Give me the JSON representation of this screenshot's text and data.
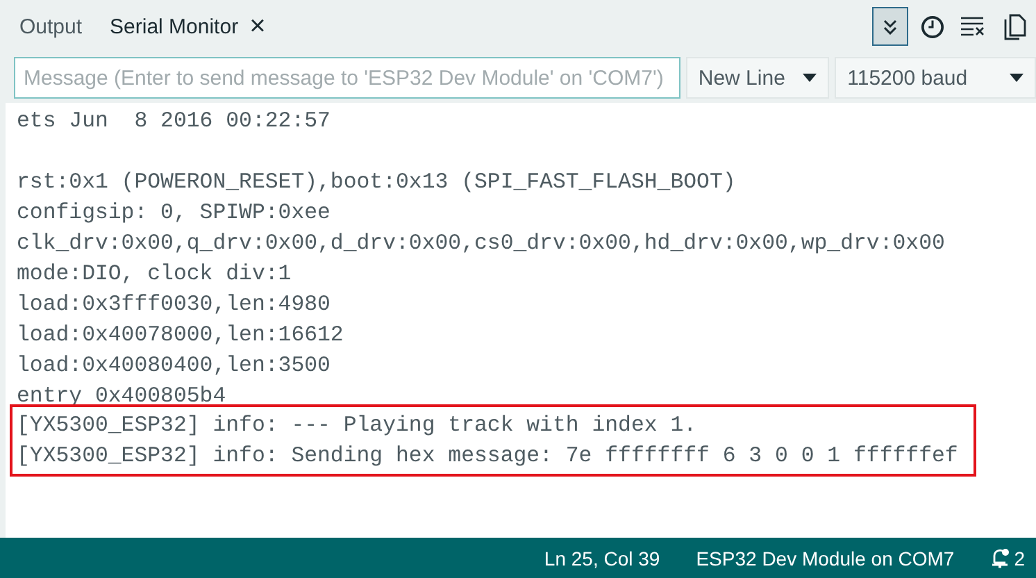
{
  "tabs": [
    {
      "label": "Output",
      "selected": false,
      "closable": false
    },
    {
      "label": "Serial Monitor",
      "selected": true,
      "closable": true,
      "close_glyph": "×"
    }
  ],
  "toolbar": {
    "autoscroll_on": true,
    "timestamp_on": false
  },
  "message_field": {
    "placeholder": "Message (Enter to send message to 'ESP32 Dev Module' on 'COM7')"
  },
  "line_ending": {
    "value": "New Line"
  },
  "baud_rate": {
    "value": "115200 baud"
  },
  "log": [
    {
      "kind": "text",
      "text": "ets Jun  8 2016 00:22:57"
    },
    {
      "kind": "blank"
    },
    {
      "kind": "text",
      "text": "rst:0x1 (POWERON_RESET),boot:0x13 (SPI_FAST_FLASH_BOOT)"
    },
    {
      "kind": "text",
      "text": "configsip: 0, SPIWP:0xee"
    },
    {
      "kind": "text",
      "text": "clk_drv:0x00,q_drv:0x00,d_drv:0x00,cs0_drv:0x00,hd_drv:0x00,wp_drv:0x00"
    },
    {
      "kind": "text",
      "text": "mode:DIO, clock div:1"
    },
    {
      "kind": "text",
      "text": "load:0x3fff0030,len:4980"
    },
    {
      "kind": "text",
      "text": "load:0x40078000,len:16612"
    },
    {
      "kind": "text",
      "text": "load:0x40080400,len:3500"
    },
    {
      "kind": "text",
      "text": "entry 0x400805b4"
    }
  ],
  "highlighted_log": [
    {
      "kind": "text",
      "text": "[YX5300_ESP32] info: --- Playing track with index 1."
    },
    {
      "kind": "text",
      "text": "[YX5300_ESP32] info: Sending hex message: 7e ffffffff 6 3 0 0 1 ffffffef"
    }
  ],
  "status_bar": {
    "position": "Ln 25, Col 39",
    "board": "ESP32 Dev Module on COM7",
    "notifications": "2"
  }
}
